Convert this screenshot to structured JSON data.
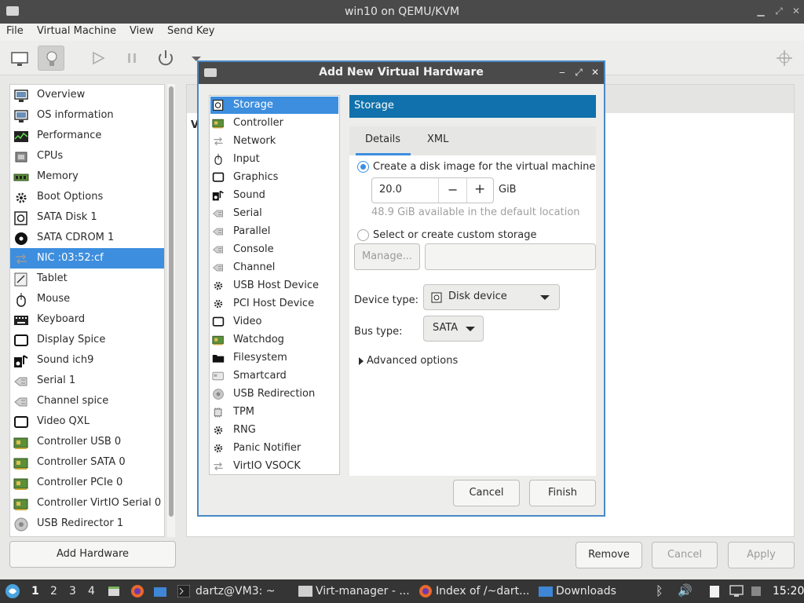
{
  "window": {
    "title": "win10 on QEMU/KVM"
  },
  "menubar": [
    "File",
    "Virtual Machine",
    "View",
    "Send Key"
  ],
  "hardware_list": [
    {
      "label": "Overview",
      "icon": "monitor-icon"
    },
    {
      "label": "OS information",
      "icon": "monitor-icon"
    },
    {
      "label": "Performance",
      "icon": "graph-icon"
    },
    {
      "label": "CPUs",
      "icon": "cpu-icon"
    },
    {
      "label": "Memory",
      "icon": "memory-icon"
    },
    {
      "label": "Boot Options",
      "icon": "gear-icon"
    },
    {
      "label": "SATA Disk 1",
      "icon": "disk-icon"
    },
    {
      "label": "SATA CDROM 1",
      "icon": "cdrom-icon"
    },
    {
      "label": "NIC :03:52:cf",
      "icon": "network-icon",
      "selected": true
    },
    {
      "label": "Tablet",
      "icon": "tablet-icon"
    },
    {
      "label": "Mouse",
      "icon": "mouse-icon"
    },
    {
      "label": "Keyboard",
      "icon": "keyboard-icon"
    },
    {
      "label": "Display Spice",
      "icon": "display-icon"
    },
    {
      "label": "Sound ich9",
      "icon": "sound-icon"
    },
    {
      "label": "Serial 1",
      "icon": "serial-icon"
    },
    {
      "label": "Channel spice",
      "icon": "serial-icon"
    },
    {
      "label": "Video QXL",
      "icon": "display-icon"
    },
    {
      "label": "Controller USB 0",
      "icon": "controller-icon"
    },
    {
      "label": "Controller SATA 0",
      "icon": "controller-icon"
    },
    {
      "label": "Controller PCIe 0",
      "icon": "controller-icon"
    },
    {
      "label": "Controller VirtIO Serial 0",
      "icon": "controller-icon"
    },
    {
      "label": "USB Redirector 1",
      "icon": "usb-redir-icon"
    }
  ],
  "buttons": {
    "add_hardware": "Add Hardware",
    "remove": "Remove",
    "cancel": "Cancel",
    "apply": "Apply"
  },
  "right_panel": {
    "partial_label": "V"
  },
  "dialog": {
    "title": "Add New Virtual Hardware",
    "device_types": [
      {
        "label": "Storage",
        "icon": "disk-icon",
        "selected": true
      },
      {
        "label": "Controller",
        "icon": "controller-icon"
      },
      {
        "label": "Network",
        "icon": "network-icon"
      },
      {
        "label": "Input",
        "icon": "mouse-icon"
      },
      {
        "label": "Graphics",
        "icon": "display-icon"
      },
      {
        "label": "Sound",
        "icon": "sound-icon"
      },
      {
        "label": "Serial",
        "icon": "serial-icon"
      },
      {
        "label": "Parallel",
        "icon": "serial-icon"
      },
      {
        "label": "Console",
        "icon": "serial-icon"
      },
      {
        "label": "Channel",
        "icon": "serial-icon"
      },
      {
        "label": "USB Host Device",
        "icon": "gear-icon"
      },
      {
        "label": "PCI Host Device",
        "icon": "gear-icon"
      },
      {
        "label": "Video",
        "icon": "display-icon"
      },
      {
        "label": "Watchdog",
        "icon": "controller-icon"
      },
      {
        "label": "Filesystem",
        "icon": "folder-icon"
      },
      {
        "label": "Smartcard",
        "icon": "smartcard-icon"
      },
      {
        "label": "USB Redirection",
        "icon": "usb-redir-icon"
      },
      {
        "label": "TPM",
        "icon": "chip-icon"
      },
      {
        "label": "RNG",
        "icon": "gear-icon"
      },
      {
        "label": "Panic Notifier",
        "icon": "gear-icon"
      },
      {
        "label": "VirtIO VSOCK",
        "icon": "network-icon"
      }
    ],
    "section_header": "Storage",
    "tabs": [
      "Details",
      "XML"
    ],
    "create_disk_label": "Create a disk image for the virtual machine",
    "disk_size": "20.0",
    "unit": "GiB",
    "available_text": "48.9 GiB available in the default location",
    "custom_storage_label": "Select or create custom storage",
    "manage_label": "Manage...",
    "device_type_label": "Device type:",
    "device_type_value": "Disk device",
    "bus_type_label": "Bus type:",
    "bus_type_value": "SATA",
    "advanced_label": "Advanced options",
    "cancel_label": "Cancel",
    "finish_label": "Finish"
  },
  "taskbar": {
    "workspaces": [
      "1",
      "2",
      "3",
      "4"
    ],
    "tasks": [
      "dartz@VM3: ~",
      "Virt-manager - ...",
      "Index of /~dart...",
      "Downloads"
    ],
    "clock": "15:20"
  },
  "colors": {
    "accent": "#3d8ede",
    "header_blue": "#1071ac",
    "titlebar": "#4a4a4a"
  }
}
